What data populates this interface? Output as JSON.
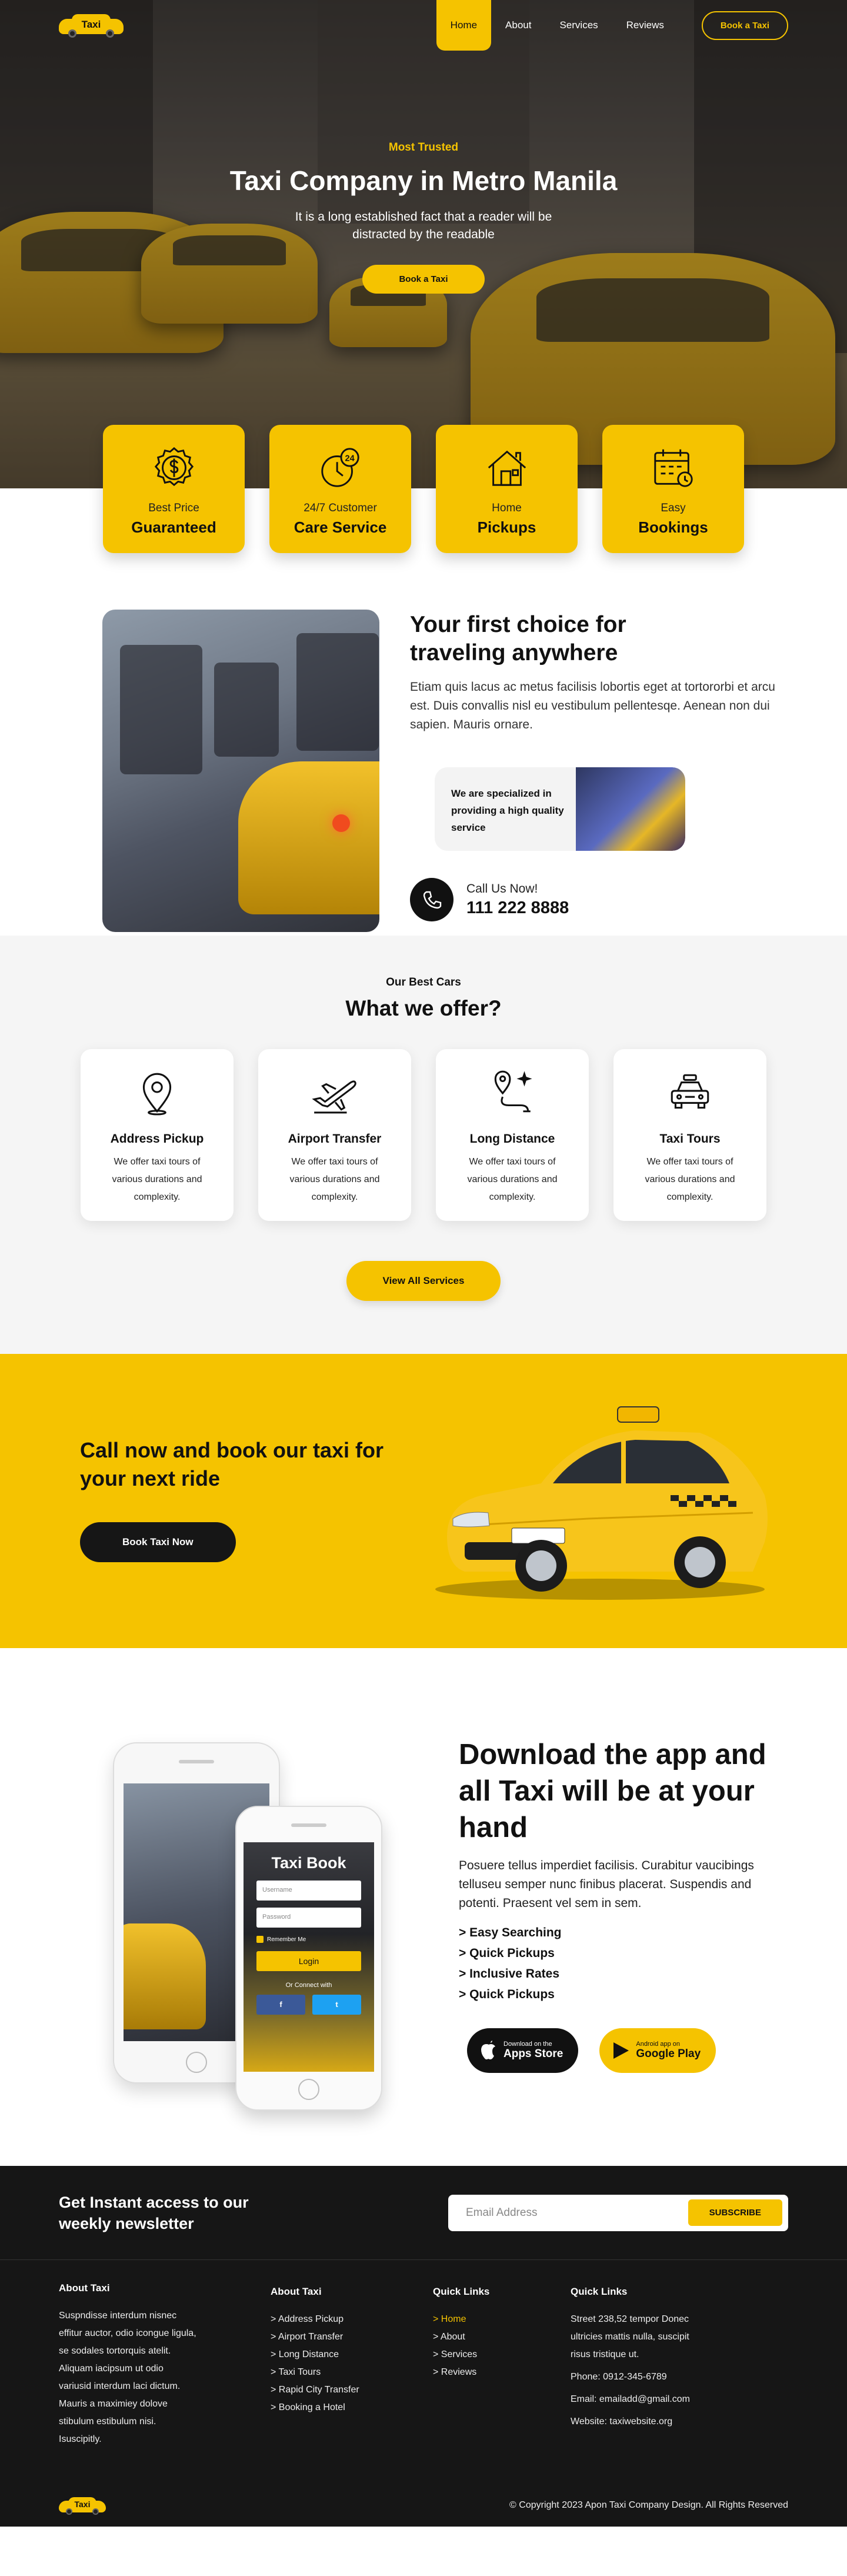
{
  "brand": {
    "logo_text": "Taxi"
  },
  "nav": {
    "links": [
      "Home",
      "About",
      "Services",
      "Reviews"
    ],
    "active": "Home",
    "cta": "Book a Taxi"
  },
  "hero": {
    "eyebrow": "Most Trusted",
    "title": "Taxi Company in Metro Manila",
    "subtitle": "It is a long established fact that a reader will be distracted by the readable",
    "button": "Book a Taxi"
  },
  "features": [
    {
      "icon": "dollar-badge-icon",
      "line1": "Best Price",
      "line2": "Guaranteed"
    },
    {
      "icon": "clock-24-icon",
      "line1": "24/7 Customer",
      "line2": "Care Service"
    },
    {
      "icon": "house-icon",
      "line1": "Home",
      "line2": "Pickups"
    },
    {
      "icon": "calendar-icon",
      "line1": "Easy",
      "line2": "Bookings"
    }
  ],
  "about": {
    "title": "Your first choice for traveling anywhere",
    "paragraph": "Etiam quis lacus ac metus facilisis lobortis eget at tortororbi et arcu est. Duis convallis nisl eu vestibulum pellentesqe. Aenean non dui sapien. Mauris ornare.",
    "specialized": "We are specialized in providing a high quality service",
    "call_label": "Call Us Now!",
    "phone": "111 222 8888"
  },
  "services": {
    "eyebrow": "Our Best Cars",
    "title": "What we offer?",
    "items": [
      {
        "icon": "location-pin-icon",
        "name": "Address Pickup",
        "desc": "We offer taxi tours of various durations and complexity."
      },
      {
        "icon": "airplane-icon",
        "name": "Airport Transfer",
        "desc": "We offer taxi tours of various durations and complexity."
      },
      {
        "icon": "route-icon",
        "name": "Long Distance",
        "desc": "We offer taxi tours of various durations and complexity."
      },
      {
        "icon": "taxi-icon",
        "name": "Taxi Tours",
        "desc": "We offer taxi tours of various durations and complexity."
      }
    ],
    "button": "View All Services"
  },
  "cta": {
    "title": "Call now and book our taxi for your next ride",
    "button": "Book Taxi Now"
  },
  "app": {
    "title": "Download the app and all Taxi will be at your hand",
    "paragraph": "Posuere tellus imperdiet facilisis. Curabitur vaucibings telluseu semper nunc finibus placerat. Suspendis and potenti. Praesent vel sem in sem.",
    "list": [
      "> Easy Searching",
      "> Quick Pickups",
      "> Inclusive Rates",
      "> Quick Pickups"
    ],
    "phone": {
      "title": "Taxi Book",
      "username": "Username",
      "password": "Password",
      "remember": "Remember Me",
      "login": "Login",
      "or_connect": "Or Connect with",
      "fb": "f",
      "tw": "t"
    },
    "stores": [
      {
        "line1": "Download on the",
        "line2": "Apps Store"
      },
      {
        "line1": "Android app on",
        "line2": "Google Play"
      }
    ]
  },
  "newsletter": {
    "title": "Get Instant access to our weekly newsletter",
    "placeholder": "Email Address",
    "button": "SUBSCRIBE"
  },
  "footer": {
    "about_heading": "About Taxi",
    "about_text": "Suspndisse interdum nisnec effitur auctor, odio icongue ligula, se sodales tortorquis atelit. Aliquam iacipsum ut odio variusid interdum laci dictum. Mauris a maximiey dolove stibulum estibulum nisi. Isuscipitly.",
    "services_heading": "About Taxi",
    "services": [
      "> Address Pickup",
      "> Airport Transfer",
      "> Long Distance",
      "> Taxi Tours",
      "> Rapid City Transfer",
      "> Booking a Hotel"
    ],
    "links_heading": "Quick Links",
    "links": [
      "> Home",
      "> About",
      "> Services",
      "> Reviews"
    ],
    "contact_heading": "Quick Links",
    "address": "Street 238,52 tempor Donec ultricies mattis nulla, suscipit risus tristique ut.",
    "phone": "Phone: 0912-345-6789",
    "email": "Email: emailadd@gmail.com",
    "website": "Website: taxiwebsite.org",
    "copyright": "© Copyright 2023 Apon Taxi Company Design. All Rights Reserved"
  },
  "colors": {
    "accent": "#f5c300",
    "dark": "#161616",
    "light_bg": "#f5f5f5"
  }
}
